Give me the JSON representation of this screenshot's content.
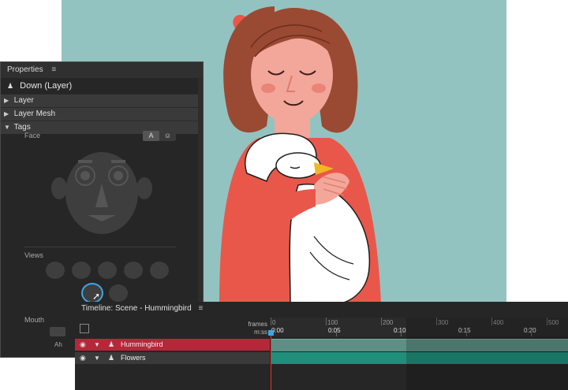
{
  "properties": {
    "title": "Properties",
    "layer_name": "Down (Layer)",
    "sections": [
      {
        "label": "Layer",
        "expanded": false
      },
      {
        "label": "Layer Mesh",
        "expanded": false
      },
      {
        "label": "Tags",
        "expanded": true
      }
    ],
    "face_label": "Face",
    "face_toggle_a": "A",
    "face_toggle_b": "☺",
    "views_label": "Views",
    "mouth_label": "Mouth",
    "mouth_item": "Ah"
  },
  "timeline": {
    "title": "Timeline: Scene - Hummingbird",
    "frames_caption": "frames",
    "time_caption": "m:ss",
    "frame_ticks": [
      "0",
      "100",
      "200",
      "300",
      "400",
      "500"
    ],
    "time_ticks": [
      "0:00",
      "0:05",
      "0:10",
      "0:15",
      "0:20"
    ],
    "tracks": [
      {
        "name": "Hummingbird",
        "selected": true
      },
      {
        "name": "Flowers",
        "selected": false
      }
    ]
  },
  "colors": {
    "canvas_bg": "#93c3c0",
    "selected_track": "#b5283a",
    "track_bar_selected": "#5d8f84",
    "track_bar": "#1f8f7b",
    "accent": "#3aa7e4"
  }
}
